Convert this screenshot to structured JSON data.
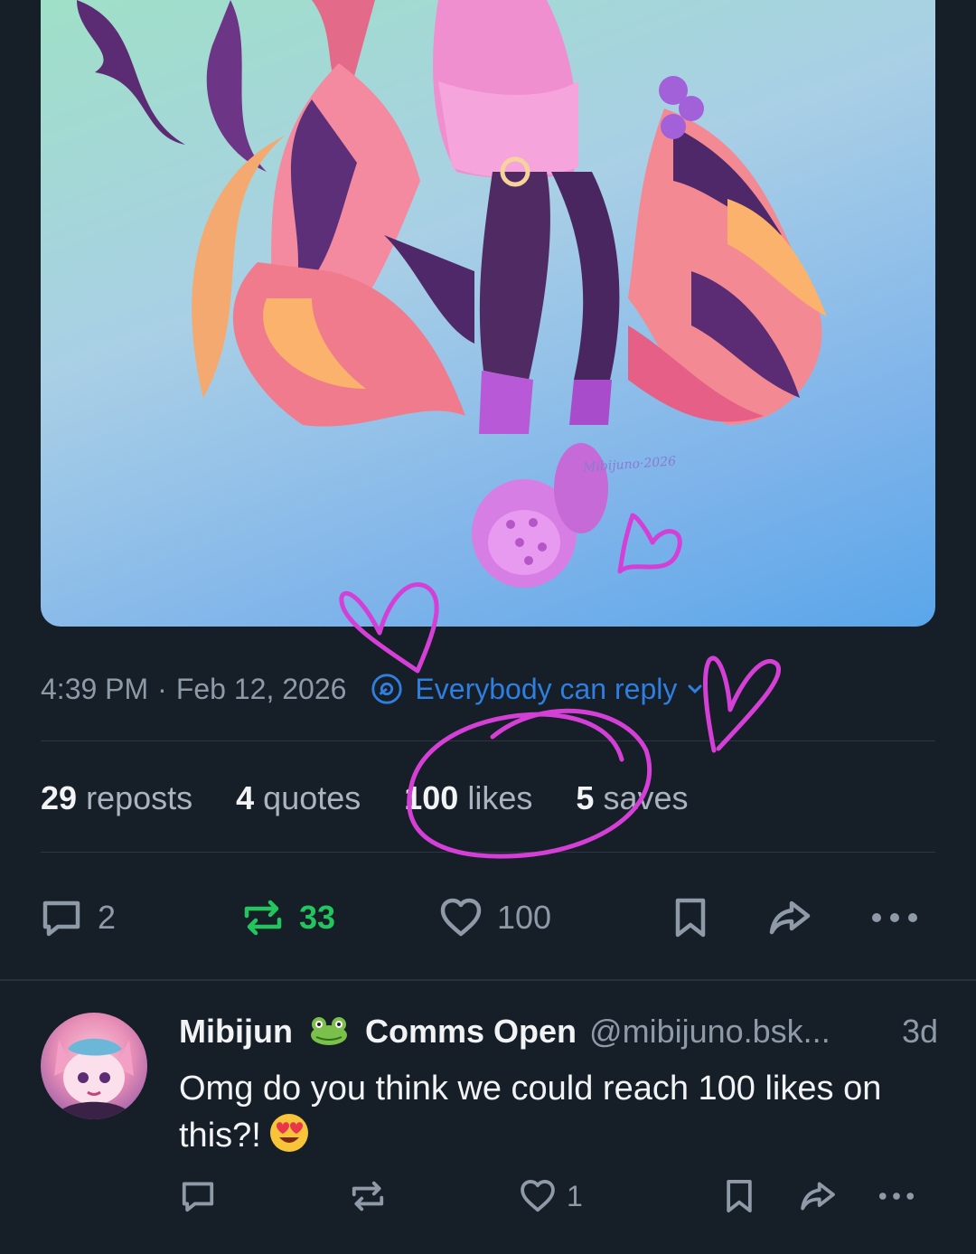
{
  "post": {
    "time": "4:39 PM",
    "separator": "·",
    "date": "Feb 12, 2026",
    "reply_setting": "Everybody can reply",
    "artwork_signature": "Mibijuno·2026",
    "stats": {
      "reposts_count": "29",
      "reposts_label": "reposts",
      "quotes_count": "4",
      "quotes_label": "quotes",
      "likes_count": "100",
      "likes_label": "likes",
      "saves_count": "5",
      "saves_label": "saves"
    },
    "actions": {
      "reply_count": "2",
      "repost_count": "33",
      "like_count": "100"
    }
  },
  "reply": {
    "name_part1": "Mibijun",
    "name_emoji": "frog",
    "name_part2": "Comms Open",
    "handle": "@mibijuno.bsk...",
    "time": "3d",
    "text": "Omg do you think we could reach 100 likes on this?!",
    "text_emoji": "smiling-face-with-heart-eyes",
    "like_count": "1"
  },
  "colors": {
    "background": "#161e27",
    "accent_blue": "#2f7fe0",
    "repost_green": "#22c55e",
    "muted_text": "#8f9aa8",
    "annotation_magenta": "#d43fd6"
  }
}
